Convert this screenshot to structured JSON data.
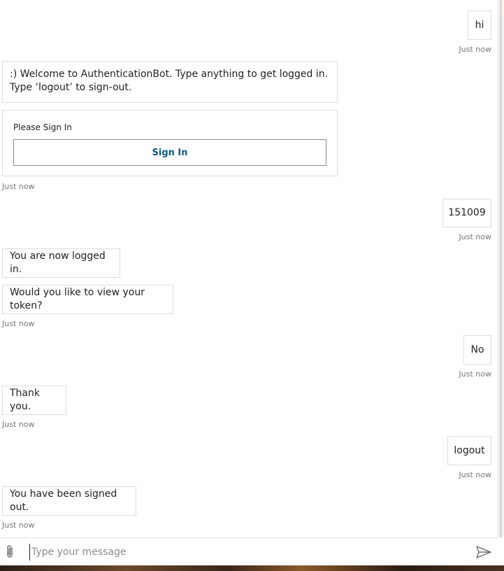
{
  "messages": [
    {
      "text": "hi",
      "timestamp": "Just now"
    },
    {
      "text": ":) Welcome to AuthenticationBot. Type anything to get logged in. Type ‘logout’ to sign-out."
    },
    {
      "card_title": "Please Sign In",
      "button_label": "Sign In",
      "timestamp": "Just now"
    },
    {
      "text": "151009",
      "timestamp": "Just now"
    },
    {
      "text": "You are now logged in."
    },
    {
      "text": "Would you like to view your token?",
      "timestamp": "Just now"
    },
    {
      "text": "No",
      "timestamp": "Just now"
    },
    {
      "text": "Thank you.",
      "timestamp": "Just now"
    },
    {
      "text": "logout",
      "timestamp": "Just now"
    },
    {
      "text": "You have been signed out.",
      "timestamp": "Just now"
    }
  ],
  "composer": {
    "placeholder": "Type your message",
    "attach_icon": "paperclip-icon",
    "send_icon": "send-icon"
  },
  "colors": {
    "accent_text": "#0e5a87",
    "border": "#dcdcdc",
    "timestamp": "#767676"
  }
}
